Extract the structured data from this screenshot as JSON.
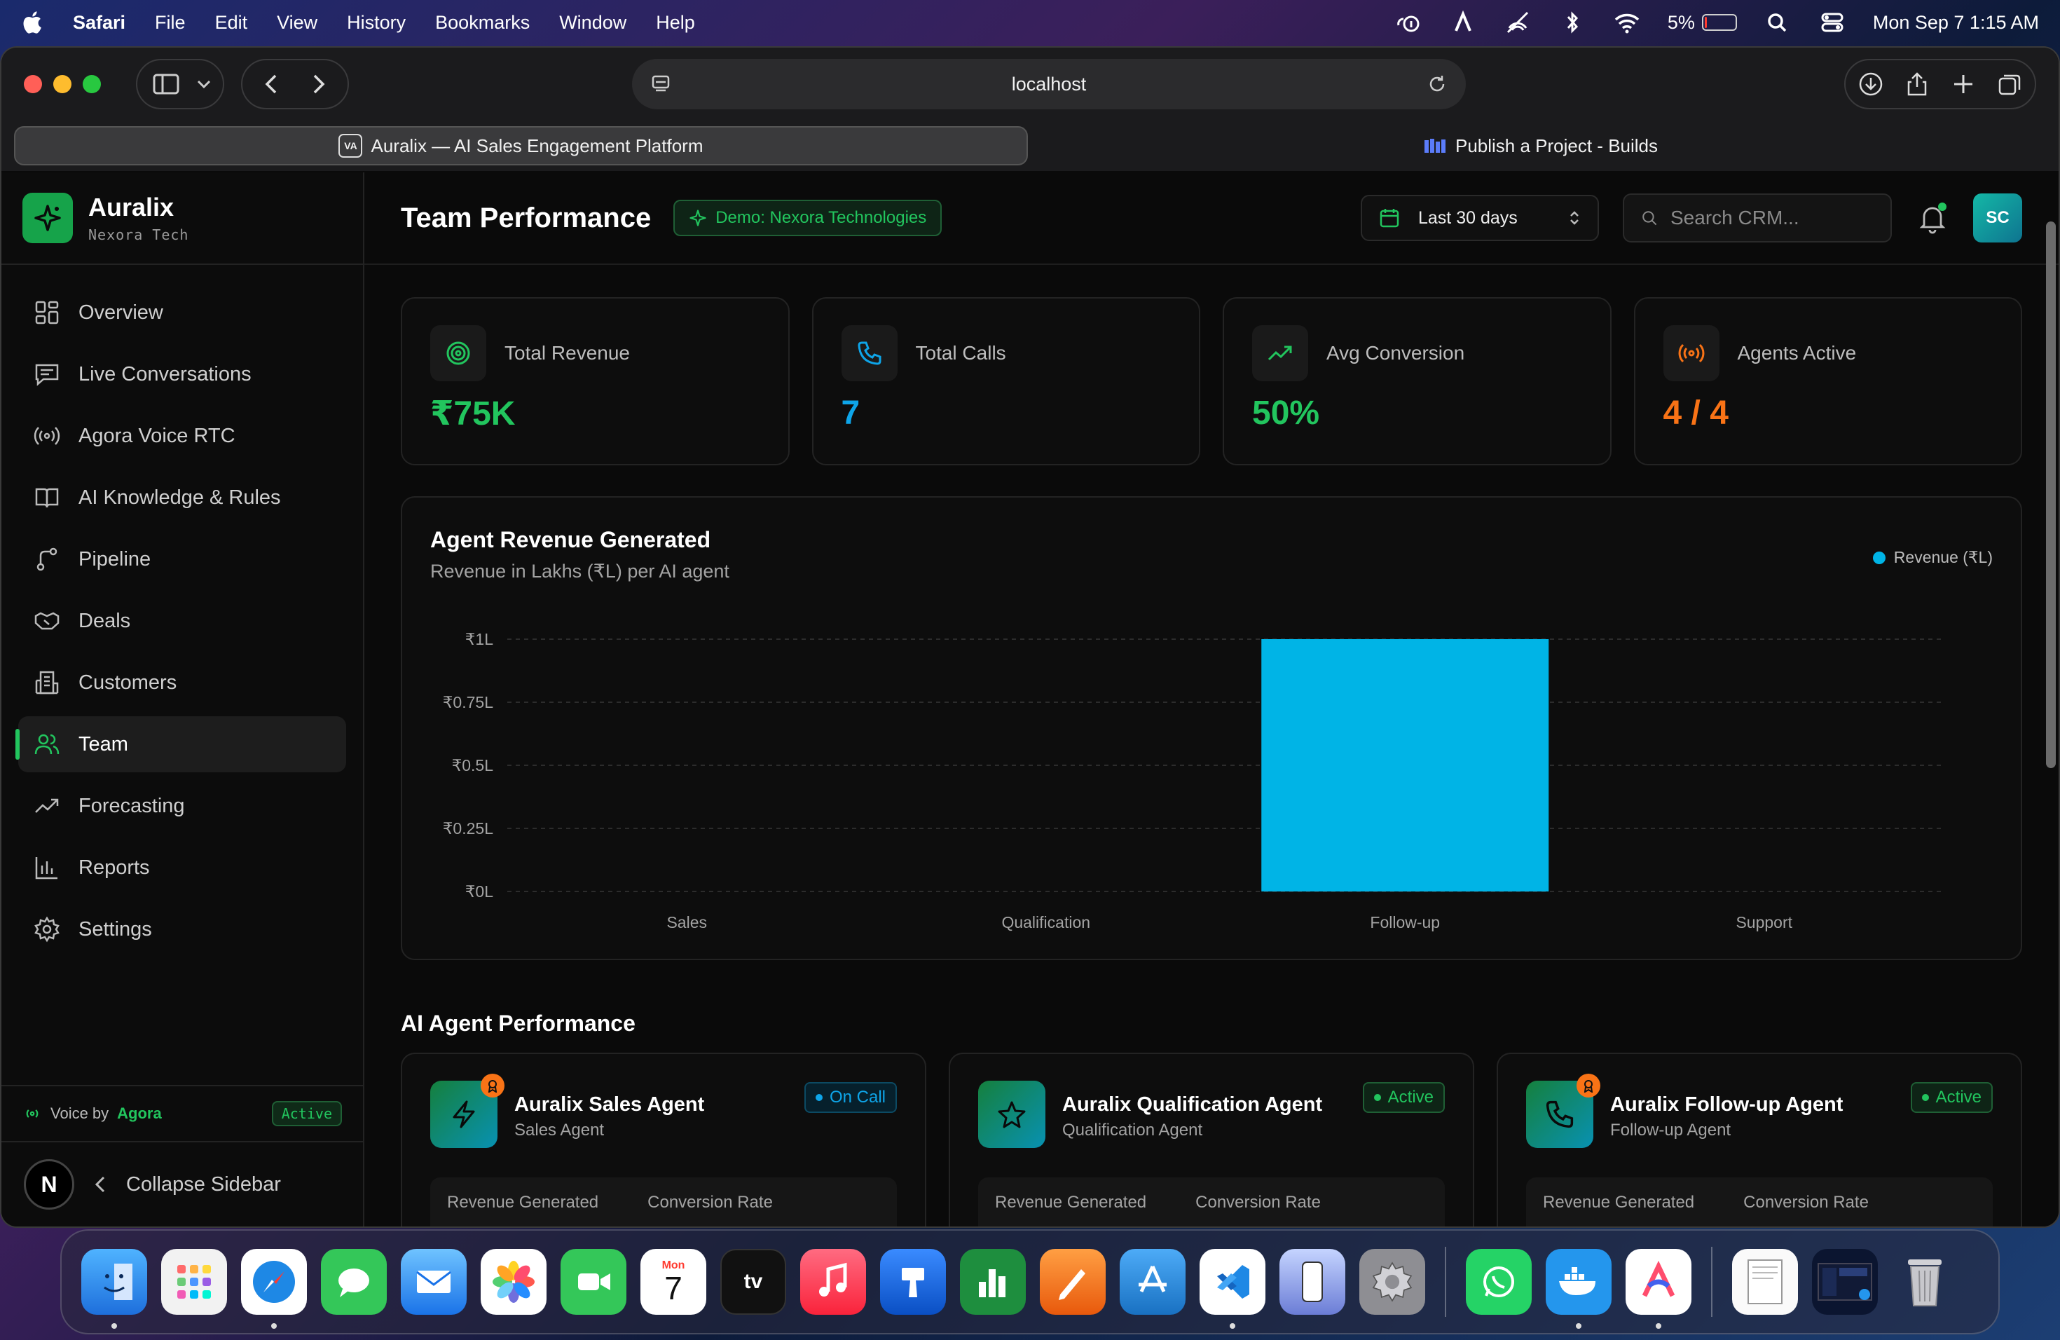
{
  "menubar": {
    "app_name": "Safari",
    "items": [
      "File",
      "Edit",
      "View",
      "History",
      "Bookmarks",
      "Window",
      "Help"
    ],
    "battery_percent": "5%",
    "datetime": "Mon Sep 7  1:15 AM"
  },
  "browser": {
    "url": "localhost",
    "tabs": [
      {
        "label": "Auralix — AI Sales Engagement Platform",
        "favicon": "VA",
        "active": true
      },
      {
        "label": "Publish a Project - Builds",
        "active": false
      }
    ]
  },
  "sidebar": {
    "brand_name": "Auralix",
    "brand_sub": "Nexora Tech",
    "items": [
      {
        "label": "Overview",
        "icon": "grid-icon"
      },
      {
        "label": "Live Conversations",
        "icon": "chat-icon"
      },
      {
        "label": "Agora Voice RTC",
        "icon": "broadcast-icon"
      },
      {
        "label": "AI Knowledge & Rules",
        "icon": "book-icon"
      },
      {
        "label": "Pipeline",
        "icon": "branch-icon"
      },
      {
        "label": "Deals",
        "icon": "handshake-icon"
      },
      {
        "label": "Customers",
        "icon": "building-icon"
      },
      {
        "label": "Team",
        "icon": "users-icon",
        "active": true
      },
      {
        "label": "Forecasting",
        "icon": "trend-icon"
      },
      {
        "label": "Reports",
        "icon": "bar-chart-icon"
      },
      {
        "label": "Settings",
        "icon": "gear-icon"
      }
    ],
    "voice_prefix": "Voice by",
    "voice_brand": "Agora",
    "voice_status": "Active",
    "avatar_letter": "N",
    "collapse_label": "Collapse Sidebar"
  },
  "header": {
    "title": "Team Performance",
    "demo_badge": "Demo: Nexora Technologies",
    "date_range": "Last 30 days",
    "search_placeholder": "Search CRM...",
    "user_initials": "SC"
  },
  "stats": [
    {
      "label": "Total Revenue",
      "value": "₹75K",
      "color": "#22c55e",
      "icon": "target-icon"
    },
    {
      "label": "Total Calls",
      "value": "7",
      "color": "#0ea5e9",
      "icon": "phone-icon"
    },
    {
      "label": "Avg Conversion",
      "value": "50%",
      "color": "#22c55e",
      "icon": "trend-up-icon"
    },
    {
      "label": "Agents Active",
      "value": "4 / 4",
      "color": "#f97316",
      "icon": "broadcast-icon"
    }
  ],
  "chart_data": {
    "type": "bar",
    "title": "Agent Revenue Generated",
    "subtitle": "Revenue in Lakhs (₹L) per AI agent",
    "categories": [
      "Sales",
      "Qualification",
      "Follow-up",
      "Support"
    ],
    "series": [
      {
        "name": "Revenue (₹L)",
        "values": [
          0,
          0,
          1,
          0
        ],
        "color": "#00b4e6"
      }
    ],
    "yticks": [
      "₹0L",
      "₹0.25L",
      "₹0.5L",
      "₹0.75L",
      "₹1L"
    ],
    "ylim": [
      0,
      1
    ],
    "grid": true,
    "legend": "top-right"
  },
  "agents_section": {
    "title": "AI Agent Performance",
    "metric_labels": [
      "Revenue Generated",
      "Conversion Rate"
    ],
    "agents": [
      {
        "name": "Auralix Sales Agent",
        "role": "Sales Agent",
        "status": "On Call",
        "status_color": "#0ea5e9",
        "icon": "bolt-icon",
        "medal": true
      },
      {
        "name": "Auralix Qualification Agent",
        "role": "Qualification Agent",
        "status": "Active",
        "status_color": "#22c55e",
        "icon": "star-icon",
        "medal": false
      },
      {
        "name": "Auralix Follow-up Agent",
        "role": "Follow-up Agent",
        "status": "Active",
        "status_color": "#22c55e",
        "icon": "phone-icon",
        "medal": true
      }
    ]
  },
  "dock": {
    "apps": [
      "Finder",
      "Launchpad",
      "Safari",
      "Messages",
      "Mail",
      "Photos",
      "FaceTime",
      "Calendar",
      "TV",
      "Music",
      "Keynote",
      "Numbers",
      "Pages",
      "App Store",
      "VS Code",
      "iPhone Mirroring",
      "System Settings",
      "WhatsApp",
      "Docker",
      "Arc",
      "Document",
      "Screenshot",
      "Trash"
    ],
    "calendar_month": "Mon",
    "calendar_day": "7",
    "tv_label": "tv"
  }
}
